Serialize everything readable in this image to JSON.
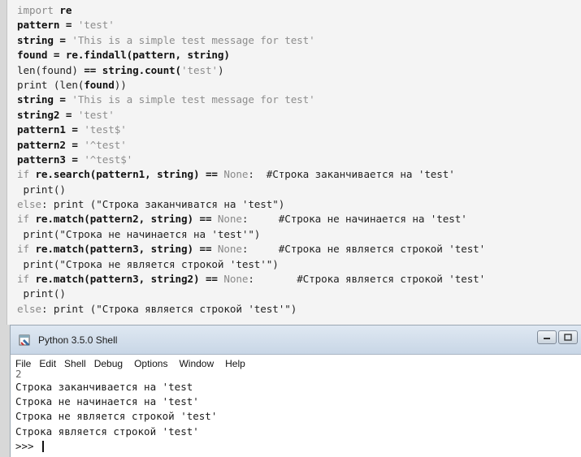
{
  "editor": {
    "lines": [
      [
        {
          "t": "import ",
          "c": "kw"
        },
        {
          "t": "re",
          "c": "bold"
        }
      ],
      [
        {
          "t": "pattern = ",
          "c": "bold"
        },
        {
          "t": "'test'",
          "c": "str"
        }
      ],
      [
        {
          "t": "string = ",
          "c": "bold"
        },
        {
          "t": "'This is a simple test message for test'",
          "c": "str"
        }
      ],
      [
        {
          "t": "found = re.findall(pattern, string)",
          "c": "bold"
        }
      ],
      [
        {
          "t": "len(found) ",
          "c": "plain"
        },
        {
          "t": "== string.count(",
          "c": "bold"
        },
        {
          "t": "'test'",
          "c": "str"
        },
        {
          "t": ")",
          "c": "plain"
        }
      ],
      [
        {
          "t": "print (len(",
          "c": "plain"
        },
        {
          "t": "found",
          "c": "bold"
        },
        {
          "t": "))",
          "c": "plain"
        }
      ],
      [
        {
          "t": "string = ",
          "c": "bold"
        },
        {
          "t": "'This is a simple test message for test'",
          "c": "str"
        }
      ],
      [
        {
          "t": "string2 = ",
          "c": "bold"
        },
        {
          "t": "'test'",
          "c": "str"
        }
      ],
      [
        {
          "t": "pattern1 = ",
          "c": "bold"
        },
        {
          "t": "'test$'",
          "c": "str"
        }
      ],
      [
        {
          "t": "pattern2 = ",
          "c": "bold"
        },
        {
          "t": "'^test'",
          "c": "str"
        }
      ],
      [
        {
          "t": "pattern3 = ",
          "c": "bold"
        },
        {
          "t": "'^test$'",
          "c": "str"
        }
      ],
      [
        {
          "t": "if ",
          "c": "kw"
        },
        {
          "t": "re.search(pattern1, string) ==",
          "c": "bold"
        },
        {
          "t": " None",
          "c": "kw"
        },
        {
          "t": ":  #Строка заканчивается на 'test'",
          "c": "comment"
        }
      ],
      [
        {
          "t": " print()",
          "c": "plain"
        }
      ],
      [
        {
          "t": "else",
          "c": "kw"
        },
        {
          "t": ": print (\"Строка заканчиватся на 'test\")",
          "c": "plain"
        }
      ],
      [
        {
          "t": "if ",
          "c": "kw"
        },
        {
          "t": "re.match(pattern2, string) ==",
          "c": "bold"
        },
        {
          "t": " None",
          "c": "kw"
        },
        {
          "t": ":     #Строка не начинается на 'test'",
          "c": "comment"
        }
      ],
      [
        {
          "t": " print(\"Строка не начинается на 'test'\")",
          "c": "plain"
        }
      ],
      [
        {
          "t": "if ",
          "c": "kw"
        },
        {
          "t": "re.match(pattern3, string) ==",
          "c": "bold"
        },
        {
          "t": " None",
          "c": "kw"
        },
        {
          "t": ":     #Строка не является строкой 'test'",
          "c": "comment"
        }
      ],
      [
        {
          "t": " print(\"Строка не является строкой 'test'\")",
          "c": "plain"
        }
      ],
      [
        {
          "t": "if ",
          "c": "kw"
        },
        {
          "t": "re.match(pattern3, string2) ==",
          "c": "bold"
        },
        {
          "t": " None",
          "c": "kw"
        },
        {
          "t": ":       #Строка является строкой 'test'",
          "c": "comment"
        }
      ],
      [
        {
          "t": " print()",
          "c": "plain"
        }
      ],
      [
        {
          "t": "else",
          "c": "kw"
        },
        {
          "t": ": print (\"Строка является строкой 'test'\")",
          "c": "plain"
        }
      ]
    ]
  },
  "shell": {
    "title": "Python 3.5.0 Shell",
    "menu": [
      "File",
      "Edit",
      "Shell",
      "Debug",
      "Options",
      "Window",
      "Help"
    ],
    "output": [
      "2",
      "Строка заканчивается на 'test",
      "Строка не начинается на 'test'",
      "Строка не является строкой 'test'",
      "Строка является строкой 'test'"
    ],
    "prompt": ">>> "
  },
  "colors": {
    "titlebar": "#c8d6e6",
    "editor_bg": "#f4f4f4",
    "shell_bg": "#ffffff"
  }
}
